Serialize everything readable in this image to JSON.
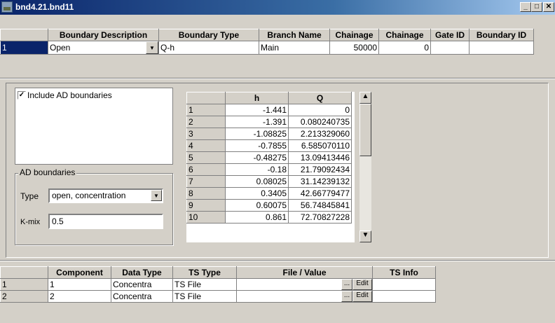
{
  "window": {
    "title": "bnd4.21.bnd11"
  },
  "boundary_grid": {
    "headers": [
      "Boundary Description",
      "Boundary Type",
      "Branch Name",
      "Chainage",
      "Chainage",
      "Gate ID",
      "Boundary ID"
    ],
    "rows": [
      {
        "index": "1",
        "description": "Open",
        "type": "Q-h",
        "branch": "Main",
        "chainage1": "50000",
        "chainage2": "0",
        "gate_id": "",
        "boundary_id": ""
      }
    ]
  },
  "ad": {
    "include_label": "Include AD boundaries",
    "include_checked": "✓",
    "group_label": "AD boundaries",
    "type_label": "Type",
    "type_value": "open, concentration",
    "kmix_label": "K-mix",
    "kmix_value": "0.5"
  },
  "qh_table": {
    "headers": [
      "h",
      "Q"
    ],
    "rows": [
      {
        "index": "1",
        "h": "-1.441",
        "q": "0"
      },
      {
        "index": "2",
        "h": "-1.391",
        "q": "0.080240735"
      },
      {
        "index": "3",
        "h": "-1.08825",
        "q": "2.213329060"
      },
      {
        "index": "4",
        "h": "-0.7855",
        "q": "6.585070110"
      },
      {
        "index": "5",
        "h": "-0.48275",
        "q": "13.09413446"
      },
      {
        "index": "6",
        "h": "-0.18",
        "q": "21.79092434"
      },
      {
        "index": "7",
        "h": "0.08025",
        "q": "31.14239132"
      },
      {
        "index": "8",
        "h": "0.3405",
        "q": "42.66779477"
      },
      {
        "index": "9",
        "h": "0.60075",
        "q": "56.74845841"
      },
      {
        "index": "10",
        "h": "0.861",
        "q": "72.70827228"
      }
    ]
  },
  "component_grid": {
    "headers": [
      "Component",
      "Data Type",
      "TS Type",
      "File / Value",
      "TS Info"
    ],
    "rows": [
      {
        "index": "1",
        "component": "1",
        "data_type": "Concentra",
        "ts_type": "TS File",
        "file_value": "",
        "browse": "...",
        "edit": "Edit",
        "ts_info": ""
      },
      {
        "index": "2",
        "component": "2",
        "data_type": "Concentra",
        "ts_type": "TS File",
        "file_value": "",
        "browse": "...",
        "edit": "Edit",
        "ts_info": ""
      }
    ]
  },
  "icons": {
    "app": "map-icon",
    "minimize": "minimize-icon",
    "maximize": "maximize-icon",
    "close": "close-icon"
  }
}
